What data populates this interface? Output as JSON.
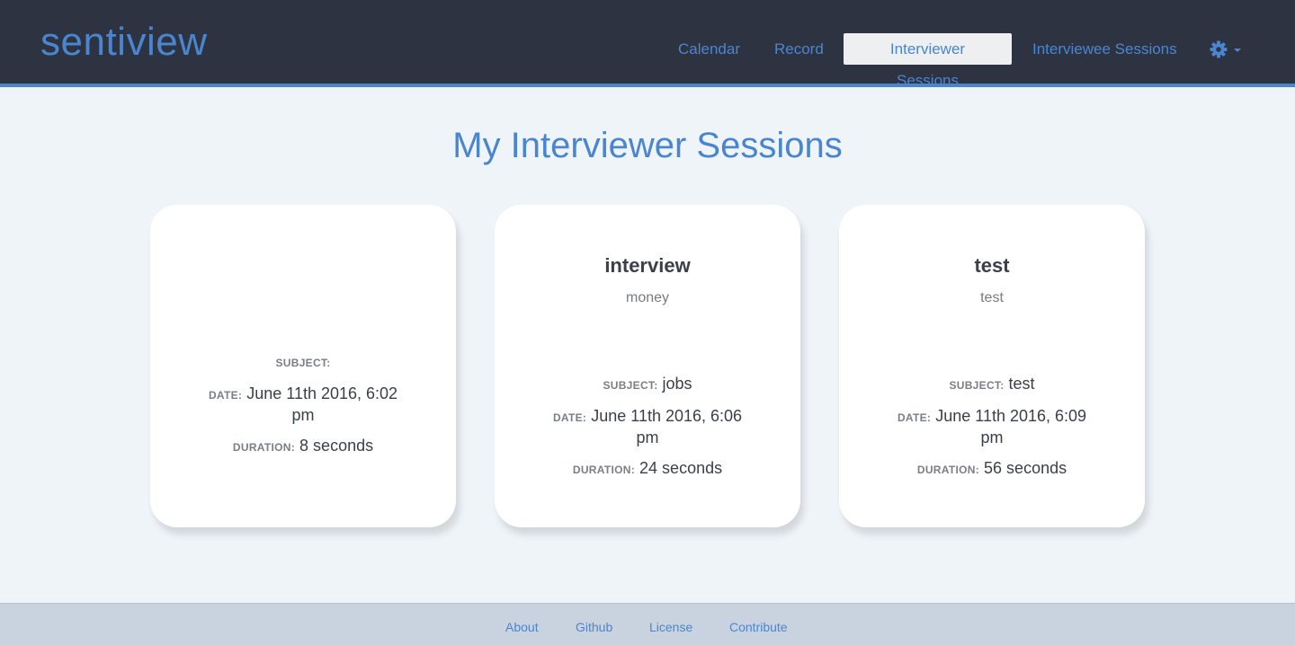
{
  "app": {
    "brand": "sentiview"
  },
  "nav": {
    "items": [
      {
        "label": "Calendar"
      },
      {
        "label": "Record"
      },
      {
        "label": "Interviewer Sessions",
        "active": true
      },
      {
        "label": "Interviewee Sessions"
      }
    ],
    "settings_icon": "gear-icon"
  },
  "main": {
    "title": "My Interviewer Sessions",
    "labels": {
      "subject": "Subject:",
      "date": "Date:",
      "duration": "Duration:"
    },
    "cards": [
      {
        "title": "",
        "description": "",
        "subject": "",
        "date": "June 11th 2016, 6:02 pm",
        "duration": "8 seconds"
      },
      {
        "title": "interview",
        "description": "money",
        "subject": "jobs",
        "date": "June 11th 2016, 6:06 pm",
        "duration": "24 seconds"
      },
      {
        "title": "test",
        "description": "test",
        "subject": "test",
        "date": "June 11th 2016, 6:09 pm",
        "duration": "56 seconds"
      }
    ]
  },
  "footer": {
    "links": [
      {
        "label": "About"
      },
      {
        "label": "Github"
      },
      {
        "label": "License"
      },
      {
        "label": "Contribute"
      }
    ]
  },
  "colors": {
    "accent": "#4a86cf",
    "navbar": "#2e3342",
    "background": "#eff4f9",
    "footer": "#c9d3df"
  }
}
